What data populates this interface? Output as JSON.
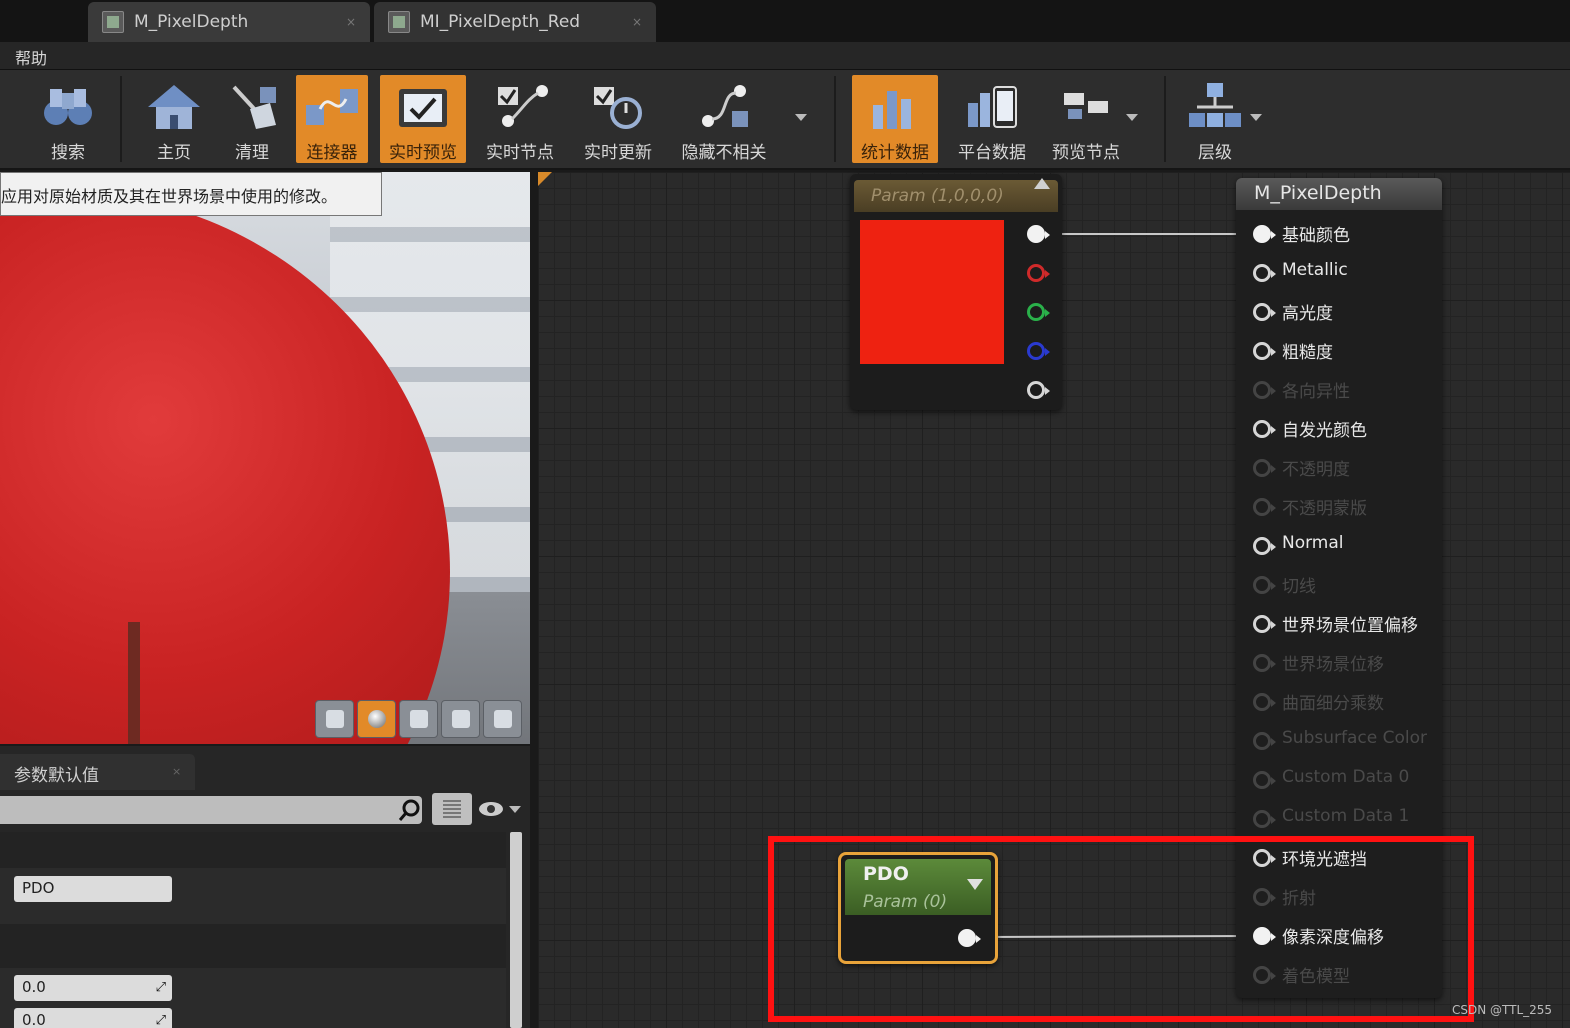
{
  "tabs": [
    {
      "label": "M_PixelDepth",
      "close": "×"
    },
    {
      "label": "MI_PixelDepth_Red",
      "close": "×"
    }
  ],
  "menu": {
    "help": "帮助"
  },
  "toolbar": {
    "items": [
      {
        "label": "搜索",
        "icon": "binoculars-icon",
        "active": false
      },
      {
        "label": "主页",
        "icon": "home-icon",
        "active": false
      },
      {
        "label": "清理",
        "icon": "broom-icon",
        "active": false
      },
      {
        "label": "连接器",
        "icon": "connector-icon",
        "active": true
      },
      {
        "label": "实时预览",
        "icon": "tv-check-icon",
        "active": true
      },
      {
        "label": "实时节点",
        "icon": "live-nodes-icon",
        "active": false
      },
      {
        "label": "实时更新",
        "icon": "live-update-icon",
        "active": false
      },
      {
        "label": "隐藏不相关",
        "icon": "hide-unrelated-icon",
        "active": false
      },
      {
        "label": "统计数据",
        "icon": "stats-icon",
        "active": true
      },
      {
        "label": "平台数据",
        "icon": "platform-stats-icon",
        "active": false
      },
      {
        "label": "预览节点",
        "icon": "preview-node-icon",
        "active": false
      },
      {
        "label": "层级",
        "icon": "hierarchy-icon",
        "active": false
      }
    ]
  },
  "viewport": {
    "tooltip": "应用对原始材质及其在世界场景中使用的修改。"
  },
  "details": {
    "tab_label": "参数默认值",
    "tab_close": "×",
    "fields": [
      {
        "value": "PDO"
      },
      {
        "value": "0.0"
      },
      {
        "value": "0.0"
      }
    ]
  },
  "graph": {
    "param_node": {
      "title": "Param (1,0,0,0)",
      "swatch_color": "#ee2211"
    },
    "result_node": {
      "title": "M_PixelDepth",
      "inputs": [
        {
          "label": "基础颜色",
          "enabled": true,
          "connected": true
        },
        {
          "label": "Metallic",
          "enabled": true,
          "connected": false
        },
        {
          "label": "高光度",
          "enabled": true,
          "connected": false
        },
        {
          "label": "粗糙度",
          "enabled": true,
          "connected": false
        },
        {
          "label": "各向异性",
          "enabled": false,
          "connected": false
        },
        {
          "label": "自发光颜色",
          "enabled": true,
          "connected": false
        },
        {
          "label": "不透明度",
          "enabled": false,
          "connected": false
        },
        {
          "label": "不透明蒙版",
          "enabled": false,
          "connected": false
        },
        {
          "label": "Normal",
          "enabled": true,
          "connected": false
        },
        {
          "label": "切线",
          "enabled": false,
          "connected": false
        },
        {
          "label": "世界场景位置偏移",
          "enabled": true,
          "connected": false
        },
        {
          "label": "世界场景位移",
          "enabled": false,
          "connected": false
        },
        {
          "label": "曲面细分乘数",
          "enabled": false,
          "connected": false
        },
        {
          "label": "Subsurface Color",
          "enabled": false,
          "connected": false
        },
        {
          "label": "Custom Data 0",
          "enabled": false,
          "connected": false
        },
        {
          "label": "Custom Data 1",
          "enabled": false,
          "connected": false
        },
        {
          "label": "环境光遮挡",
          "enabled": true,
          "connected": false
        },
        {
          "label": "折射",
          "enabled": false,
          "connected": false
        },
        {
          "label": "像素深度偏移",
          "enabled": true,
          "connected": true
        },
        {
          "label": "着色模型",
          "enabled": false,
          "connected": false
        }
      ]
    },
    "pdo_node": {
      "title": "PDO",
      "subtitle": "Param (0)"
    },
    "highlight_color": "#ff1111"
  },
  "watermark": "CSDN @TTL_255"
}
